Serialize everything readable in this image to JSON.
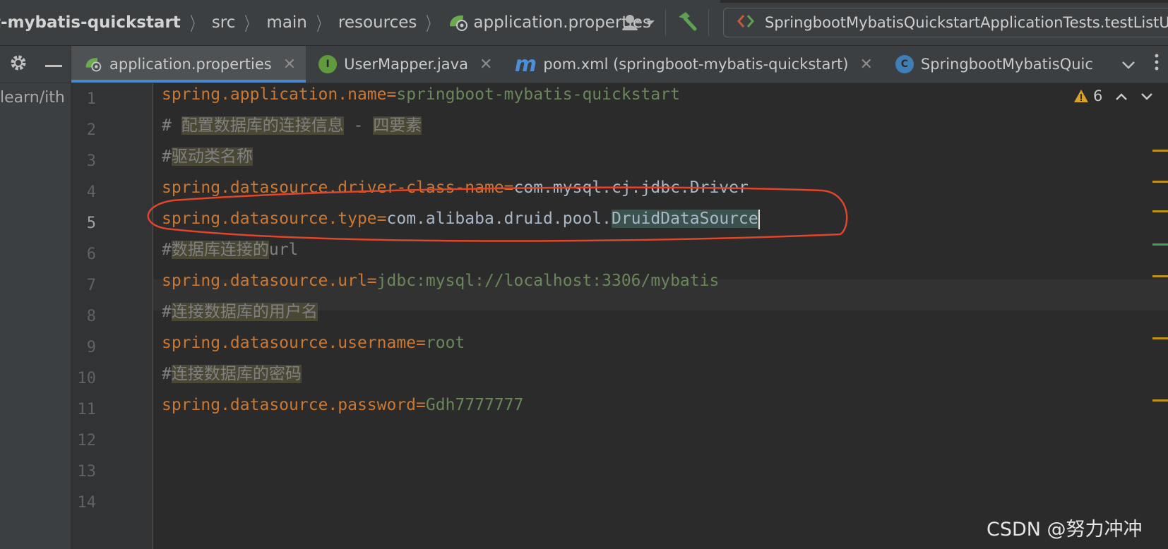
{
  "breadcrumb": {
    "items": [
      "t-mybatis-quickstart",
      "src",
      "main",
      "resources",
      "application.properties"
    ]
  },
  "run_config": {
    "label": "SpringbootMybatisQuickstartApplicationTests.testListU"
  },
  "tabs": [
    {
      "label": "application.properties",
      "icon": "spring-properties-icon",
      "active": true
    },
    {
      "label": "UserMapper.java",
      "icon": "interface-icon",
      "icon_text": "I",
      "active": false
    },
    {
      "label": "pom.xml (springboot-mybatis-quickstart)",
      "icon": "maven-icon",
      "icon_text": "m",
      "active": false
    },
    {
      "label": "SpringbootMybatisQuic",
      "icon": "class-icon",
      "icon_text": "C",
      "active": false
    }
  ],
  "project_panel": {
    "path_fragment": "learn/ith"
  },
  "editor": {
    "lines": [
      {
        "n": "1",
        "key": "spring.application.name",
        "eq": "=",
        "value": "springboot-mybatis-quickstart"
      },
      {
        "n": "2",
        "hash": "# ",
        "comment_a": "配置数据库的连接信息",
        "mid": " - ",
        "comment_b": "四要素"
      },
      {
        "n": "3",
        "hash": "#",
        "comment": "驱动类名称"
      },
      {
        "n": "4",
        "key": "spring.datasource.driver-class-name",
        "eq": "=",
        "value": "com.mysql.cj.jdbc.Driver"
      },
      {
        "n": "5",
        "key": "spring.datasource.type",
        "eq": "=",
        "value_pkg": "com.alibaba.druid.pool.",
        "value_cls": "DruidDataSource"
      },
      {
        "n": "6",
        "hash": "#",
        "comment": "数据库连接的",
        "tail": "url"
      },
      {
        "n": "7",
        "key": "spring.datasource.url",
        "eq": "=",
        "value": "jdbc:mysql://localhost:3306/mybatis"
      },
      {
        "n": "8",
        "hash": "#",
        "comment": "连接数据库的用户名"
      },
      {
        "n": "9",
        "key": "spring.datasource.username",
        "eq": "=",
        "value": "root"
      },
      {
        "n": "10",
        "hash": "#",
        "comment": "连接数据库的密码"
      },
      {
        "n": "11",
        "key": "spring.datasource.password",
        "eq": "=",
        "value": "Gdh7777777"
      },
      {
        "n": "12"
      },
      {
        "n": "13"
      },
      {
        "n": "14"
      }
    ],
    "current_line": 5
  },
  "inspection": {
    "warning_count": "6"
  },
  "watermark": "CSDN @努力冲冲",
  "colors": {
    "keyword": "#cc7832",
    "string_value": "#6a8759",
    "comment": "#808080",
    "annotation_circle": "#e0462b"
  }
}
